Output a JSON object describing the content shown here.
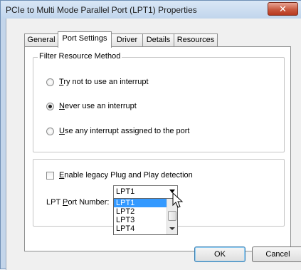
{
  "window": {
    "title": "PCIe to Multi Mode Parallel Port (LPT1) Properties",
    "close_glyph": "✕"
  },
  "tabs": [
    {
      "label": "General"
    },
    {
      "label": "Port Settings"
    },
    {
      "label": "Driver"
    },
    {
      "label": "Details"
    },
    {
      "label": "Resources"
    }
  ],
  "filter": {
    "legend": "Filter Resource Method",
    "options": [
      {
        "key": "T",
        "rest": "ry not to use an interrupt",
        "checked": false
      },
      {
        "key": "N",
        "rest": "ever use an interrupt",
        "checked": true
      },
      {
        "key": "U",
        "rest": "se any interrupt assigned to the port",
        "checked": false
      }
    ]
  },
  "legacy": {
    "key": "E",
    "rest": "nable legacy Plug and Play detection",
    "checked": false
  },
  "lpt": {
    "label_pre": "LPT ",
    "label_key": "P",
    "label_post": "ort Number:",
    "selected": "LPT1",
    "options": [
      "LPT1",
      "LPT2",
      "LPT3",
      "LPT4"
    ]
  },
  "buttons": {
    "ok": "OK",
    "cancel": "Cancel"
  },
  "colors": {
    "selection": "#3399ff",
    "close": "#c85a40"
  }
}
